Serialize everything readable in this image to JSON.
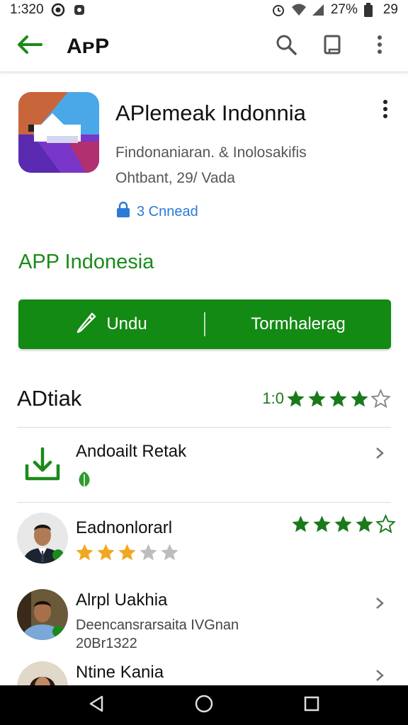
{
  "status_bar": {
    "time": "1:320",
    "battery": "27%",
    "extra": "29"
  },
  "app_bar": {
    "title": "AᴘP"
  },
  "app": {
    "name": "APlemeak Indonnia",
    "developer": "Findonaniaran. & Inolosakifis",
    "meta": "Ohtbant, 29/ Vada",
    "contains": "3 Cnnead"
  },
  "section": {
    "title": "APP Indonesia"
  },
  "buttons": {
    "left_label": "Undu",
    "right_label": "Tormhalerag"
  },
  "rating": {
    "label": "ADtiak",
    "score": "1:0",
    "filled_stars": 4,
    "total_stars": 5
  },
  "rows": [
    {
      "name": "Andoailt Retak"
    },
    {
      "name": "Eadnonlorarl",
      "review_stars_filled": 3,
      "review_stars_total": 5,
      "rating_stars_filled": 4,
      "rating_stars_total": 5
    },
    {
      "name": "Alrpl Uakhia",
      "line1": "Deencansrarsaita IVGnan",
      "line2": "20Br1322"
    },
    {
      "name": "Ntine Kania"
    }
  ],
  "colors": {
    "brand_green": "#138a13",
    "title_green": "#1a8a1a",
    "star_green": "#1a7a1a",
    "star_gold": "#f0a820",
    "star_gray": "#bdbdbd",
    "link_blue": "#2a7bd8"
  }
}
